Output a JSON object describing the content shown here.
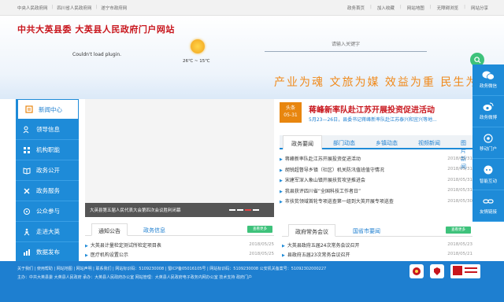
{
  "topbar": {
    "left_links": [
      "中央人民政府网",
      "四川省人民政府网",
      "遂宁市政府网"
    ],
    "right_links": [
      "政务首页",
      "加入收藏",
      "网站地图",
      "无障碍浏览",
      "网站分享"
    ]
  },
  "header": {
    "site_title": "中共大英县委  大英县人民政府门户网站",
    "plugin_message": "Couldn't load plugin.",
    "temperature": "26℃ ~ 15℃",
    "search_placeholder": "请输入关键字",
    "slogan": "产业为魂  文旅为媒  效益为重  民生为本"
  },
  "left_nav": [
    {
      "label": "新闻中心",
      "icon": "news-icon"
    },
    {
      "label": "领导信息",
      "icon": "people-icon"
    },
    {
      "label": "机构职能",
      "icon": "grid-icon"
    },
    {
      "label": "政务公开",
      "icon": "book-icon"
    },
    {
      "label": "政务服务",
      "icon": "service-icon"
    },
    {
      "label": "公众参与",
      "icon": "chat-icon"
    },
    {
      "label": "走进大英",
      "icon": "walk-icon"
    },
    {
      "label": "数据发布",
      "icon": "chart-icon"
    }
  ],
  "banner": {
    "caption": "大英县第五届人民代表大会第四次会议胜利闭幕"
  },
  "news_tabs_left": {
    "tabs": [
      "通知公告",
      "政务信息"
    ],
    "more": "查看更多",
    "items": [
      {
        "title": "大英县计量检定测试所检定项目表",
        "date": "2018/05/25"
      },
      {
        "title": "医疗机构设置公示",
        "date": "2018/05/25"
      }
    ]
  },
  "headline": {
    "badge_top": "头条",
    "badge_date": "05-31",
    "title": "蒋峰新率队赴江苏开展投资促进活动",
    "summary": "5月23—26日，县委书记蒋峰新率队赴江苏泰兴和宜兴等地..."
  },
  "news_tabs_right": {
    "tabs": [
      "政务要闻",
      "部门动态",
      "乡镇动态",
      "视频新闻",
      "图片新闻"
    ],
    "items": [
      {
        "title": "蒋峰新率队赴江苏开展投资促进活动",
        "date": "2018/05/31"
      },
      {
        "title": "胡锐超督导乡镇（社区）机关防汛值班值守情况",
        "date": "2018/05/31"
      },
      {
        "title": "宋建军深入象山镇开展扶贫攻坚推进会",
        "date": "2018/05/31"
      },
      {
        "title": "我县获评四川省“全国科技工作者日”",
        "date": "2018/05/31"
      },
      {
        "title": "市扶贫领域首轮专项巡查第一组到大英开展专项巡查",
        "date": "2018/05/30"
      }
    ]
  },
  "bottom_tabs_right": {
    "tabs": [
      "政府常务会议",
      "国省市要闻"
    ],
    "more": "查看更多",
    "items": [
      {
        "title": "大英县政府五届24次常务会议召开",
        "date": "2018/05/23"
      },
      {
        "title": "县政府五届23次常务会议召开",
        "date": "2018/05/21"
      }
    ]
  },
  "right_bar": [
    {
      "label": "政务微信",
      "icon": "wechat-icon"
    },
    {
      "label": "政务微博",
      "icon": "weibo-icon"
    },
    {
      "label": "移动门户",
      "icon": "mobile-icon"
    },
    {
      "label": "智能互动",
      "icon": "robot-icon"
    },
    {
      "label": "友情链接",
      "icon": "link-icon"
    }
  ],
  "footer": {
    "row1": "关于我们 | 使用帮助 | 网站地图 | 网站声明 | 联系我们 | 网站标识码：5109230008 | 蜀ICP备05016105号 | 网站标识码：5109230008   公安机关备案号：51092302000227",
    "row2": "主办：中共大英县委  大英县人民政府    承办：大英县人民政府办公室  网站管理：大英县人民政府电子政务内网办公室  技术支持  政府门户"
  },
  "colors": {
    "primary": "#1e8bd8",
    "accent": "#c8161d",
    "slogan": "#f08a1c",
    "green": "#3ec27b"
  }
}
